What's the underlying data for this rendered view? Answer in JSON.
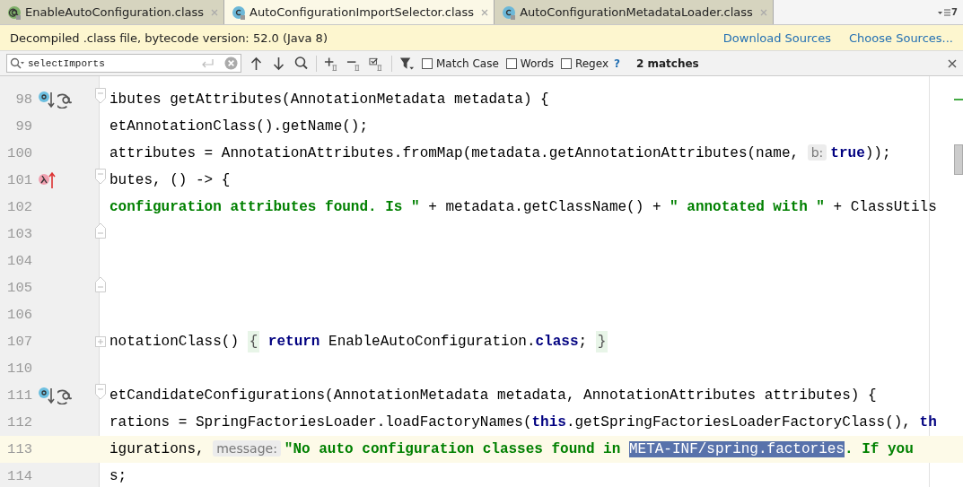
{
  "tabs": [
    {
      "label": "EnableAutoConfiguration.class",
      "kind": "annotation",
      "selected": false
    },
    {
      "label": "AutoConfigurationImportSelector.class",
      "kind": "class",
      "selected": true
    },
    {
      "label": "AutoConfigurationMetadataLoader.class",
      "kind": "class",
      "selected": false
    }
  ],
  "tab_overflow_count": "7",
  "notice": {
    "text": "Decompiled .class file, bytecode version: 52.0 (Java 8)",
    "links": [
      "Download Sources",
      "Choose Sources..."
    ]
  },
  "search": {
    "value": "selectImports",
    "options": [
      {
        "label": "Match Case",
        "checked": false
      },
      {
        "label": "Words",
        "checked": false
      },
      {
        "label": "Regex",
        "checked": false
      }
    ],
    "help": "?",
    "matches": "2 matches"
  },
  "lines": [
    {
      "number": "98",
      "gutter_icons": [
        {
          "kind": "implements"
        },
        {
          "kind": "annotation"
        }
      ],
      "fold_marker": {
        "kind": "start"
      },
      "current": false,
      "segments": [
        {
          "kind": "plain",
          "text": "ibutes getAttributes(AnnotationMetadata metadata) {"
        }
      ]
    },
    {
      "number": "99",
      "current": false,
      "segments": [
        {
          "kind": "plain",
          "text": "etAnnotationClass().getName();"
        }
      ]
    },
    {
      "number": "100",
      "current": false,
      "segments": [
        {
          "kind": "plain",
          "text": " attributes = AnnotationAttributes.fromMap(metadata.getAnnotationAttributes(name, "
        },
        {
          "kind": "hint",
          "text": "b:"
        },
        {
          "kind": "keyword",
          "text": "true"
        },
        {
          "kind": "plain",
          "text": "));"
        }
      ]
    },
    {
      "number": "101",
      "gutter_icons": [
        {
          "kind": "lambda"
        }
      ],
      "fold_marker": {
        "kind": "start"
      },
      "current": false,
      "segments": [
        {
          "kind": "plain",
          "text": "butes, () -> {"
        }
      ]
    },
    {
      "number": "102",
      "current": false,
      "segments": [
        {
          "kind": "string",
          "text": "configuration attributes found. Is \""
        },
        {
          "kind": "plain",
          "text": " + metadata.getClassName() + "
        },
        {
          "kind": "string",
          "text": "\" annotated with \""
        },
        {
          "kind": "plain",
          "text": " + ClassUtils"
        }
      ]
    },
    {
      "number": "103",
      "fold_marker": {
        "kind": "end"
      },
      "current": false
    },
    {
      "number": "104",
      "current": false
    },
    {
      "number": "105",
      "fold_marker": {
        "kind": "end"
      },
      "current": false
    },
    {
      "number": "106",
      "current": false
    },
    {
      "number": "107",
      "fold_marker": {
        "kind": "collapsed"
      },
      "current": false,
      "segments": [
        {
          "kind": "plain",
          "text": "notationClass() "
        },
        {
          "kind": "folded",
          "text": "{"
        },
        {
          "kind": "keyword",
          "text": "return"
        },
        {
          "kind": "plain",
          "text": " EnableAutoConfiguration."
        },
        {
          "kind": "keyword",
          "text": "class"
        },
        {
          "kind": "plain",
          "text": "; "
        },
        {
          "kind": "folded",
          "text": "}"
        }
      ]
    },
    {
      "number": "110",
      "current": false
    },
    {
      "number": "111",
      "gutter_icons": [
        {
          "kind": "implements"
        },
        {
          "kind": "annotation"
        }
      ],
      "fold_marker": {
        "kind": "start"
      },
      "current": false,
      "segments": [
        {
          "kind": "plain",
          "text": "etCandidateConfigurations(AnnotationMetadata metadata, AnnotationAttributes attributes) {"
        }
      ]
    },
    {
      "number": "112",
      "current": false,
      "segments": [
        {
          "kind": "plain",
          "text": "rations = SpringFactoriesLoader.loadFactoryNames("
        },
        {
          "kind": "keyword",
          "text": "this"
        },
        {
          "kind": "plain",
          "text": ".getSpringFactoriesLoaderFactoryClass(), "
        },
        {
          "kind": "keyword",
          "text": "th"
        }
      ]
    },
    {
      "number": "113",
      "current": true,
      "segments": [
        {
          "kind": "plain",
          "text": "igurations, "
        },
        {
          "kind": "hint",
          "text": "message:"
        },
        {
          "kind": "string",
          "text": "\"No auto configuration classes found in "
        },
        {
          "kind": "selected",
          "text": "META-INF/spring.factories"
        },
        {
          "kind": "string",
          "text": ". If you"
        }
      ]
    },
    {
      "number": "114",
      "current": false,
      "segments": [
        {
          "kind": "plain",
          "text": "s;"
        }
      ]
    }
  ]
}
